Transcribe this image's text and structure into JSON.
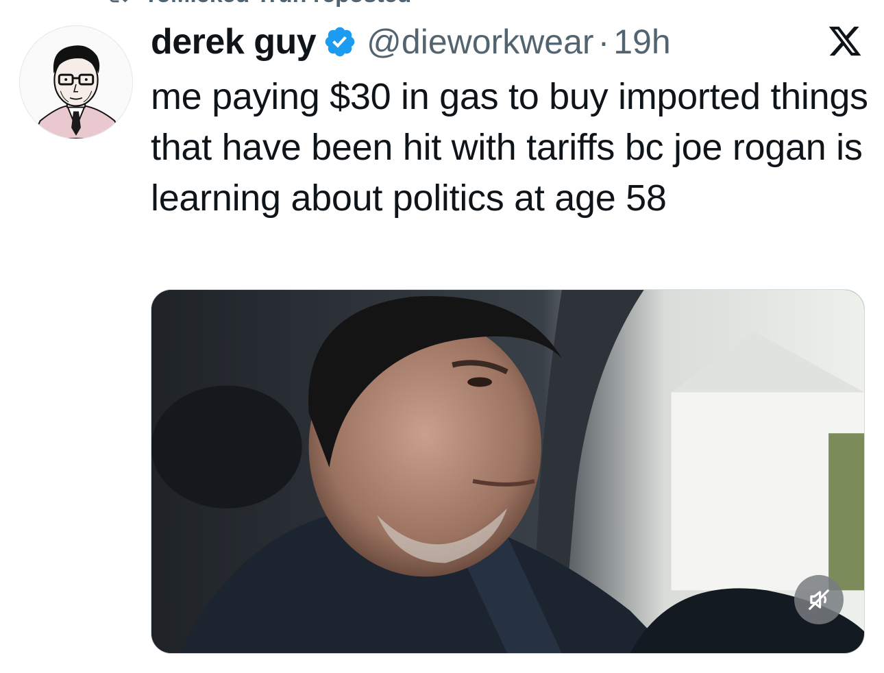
{
  "repost_banner": {
    "text": "ToMicked Truh reposted"
  },
  "tweet": {
    "author_name": "derek guy",
    "handle": "@dieworkwear",
    "separator": "·",
    "time": "19h",
    "text": "me paying $30 in gas to buy imported things that have been hit with tariffs bc joe rogan is learning about politics at age 58"
  },
  "icons": {
    "repost": "repost-icon",
    "verified": "verified-badge-icon",
    "brand": "x-logo-icon",
    "mute": "volume-muted-icon"
  },
  "colors": {
    "text": "#0f1419",
    "secondary": "#536471",
    "verified_blue": "#1d9bf0",
    "media_border": "#cfd9de"
  }
}
